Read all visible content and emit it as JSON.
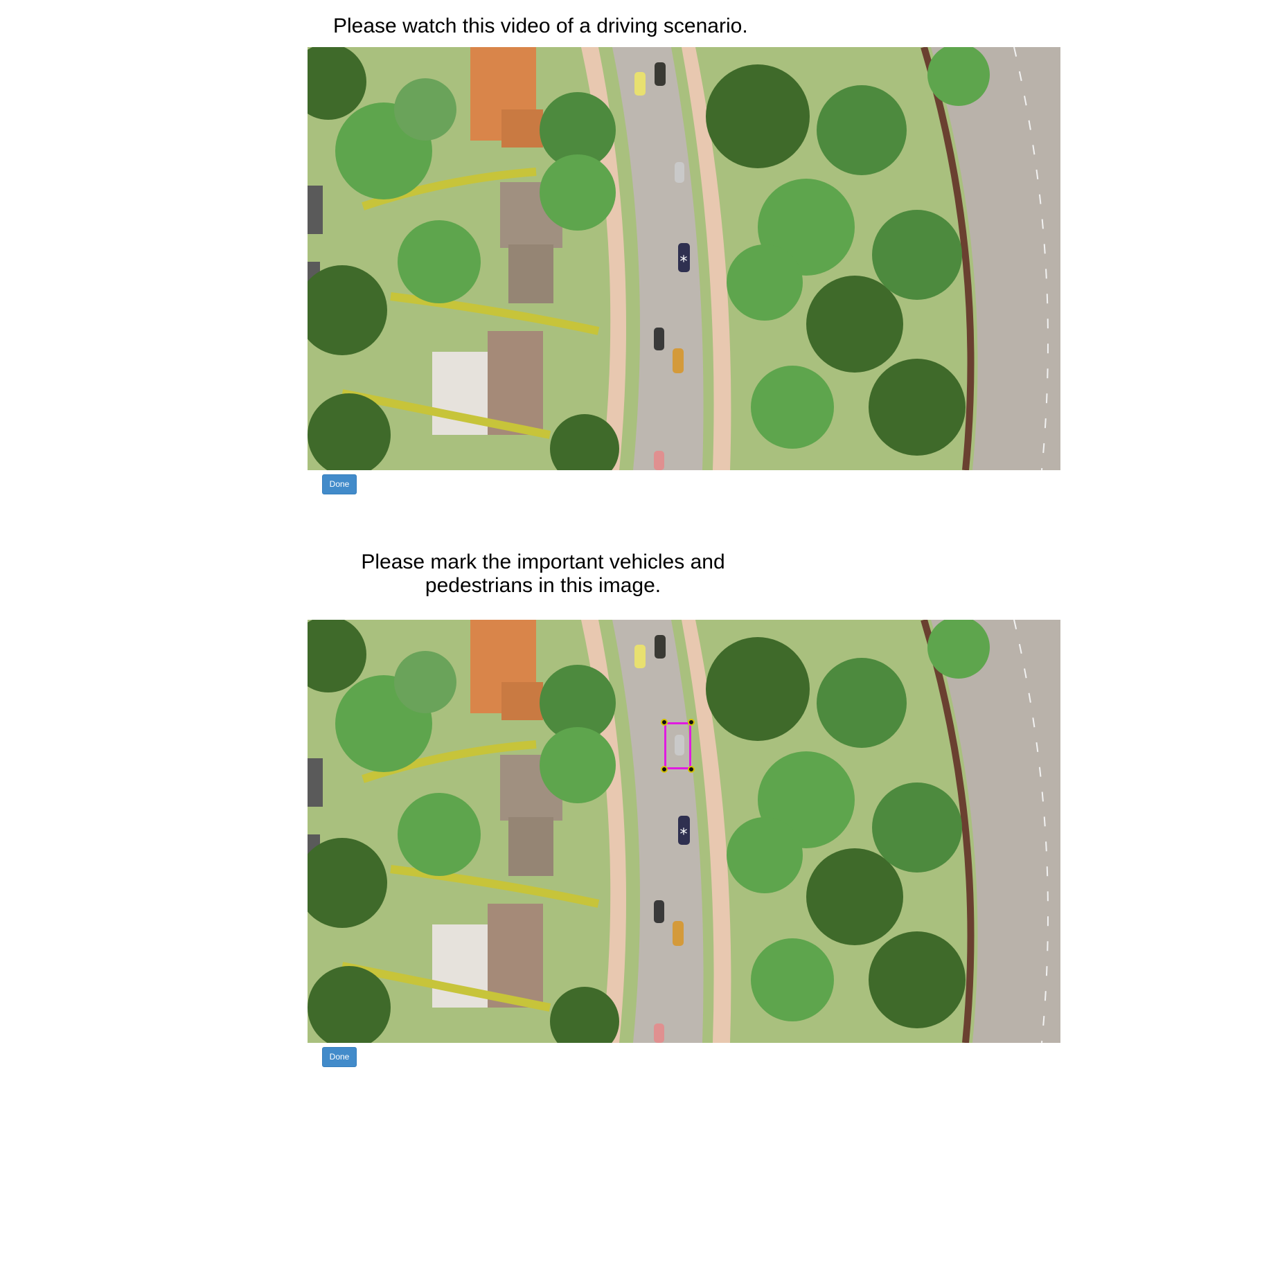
{
  "video_section": {
    "title": "Please watch this video of a driving scenario.",
    "done_label": "Done"
  },
  "annotation_section": {
    "title_line1": "Please mark the important vehicles and",
    "title_line2": "pedestrians in this image.",
    "done_label": "Done",
    "box_color": "#e01be0"
  },
  "scene": {
    "ego_marker": "*",
    "colors": {
      "grass": "#a9c07e",
      "road": "#bdb7b0",
      "sidewalk": "#e8c8b0",
      "tree_dark": "#3f6a2a",
      "tree_light": "#5ea54d",
      "roof_orange": "#d9854a",
      "roof_brown": "#a08a78"
    }
  }
}
